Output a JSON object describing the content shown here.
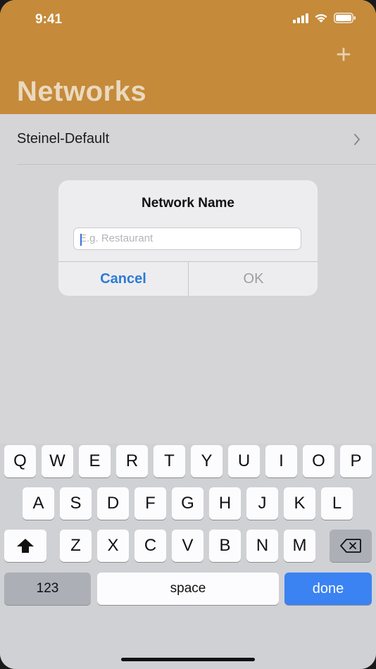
{
  "status_bar": {
    "time": "9:41"
  },
  "header": {
    "title": "Networks",
    "add_label": "+"
  },
  "list": {
    "items": [
      {
        "label": "Steinel-Default"
      }
    ]
  },
  "alert": {
    "title": "Network Name",
    "input_placeholder": "E.g. Restaurant",
    "input_value": "",
    "cancel_label": "Cancel",
    "ok_label": "OK"
  },
  "keyboard": {
    "row1": [
      "Q",
      "W",
      "E",
      "R",
      "T",
      "Y",
      "U",
      "I",
      "O",
      "P"
    ],
    "row2": [
      "A",
      "S",
      "D",
      "F",
      "G",
      "H",
      "J",
      "K",
      "L"
    ],
    "row3": [
      "Z",
      "X",
      "C",
      "V",
      "B",
      "N",
      "M"
    ],
    "numbers_label": "123",
    "space_label": "space",
    "done_label": "done"
  },
  "colors": {
    "header": "#c58a3a",
    "accent": "#2d7ad6",
    "done_key": "#3b82f2"
  }
}
